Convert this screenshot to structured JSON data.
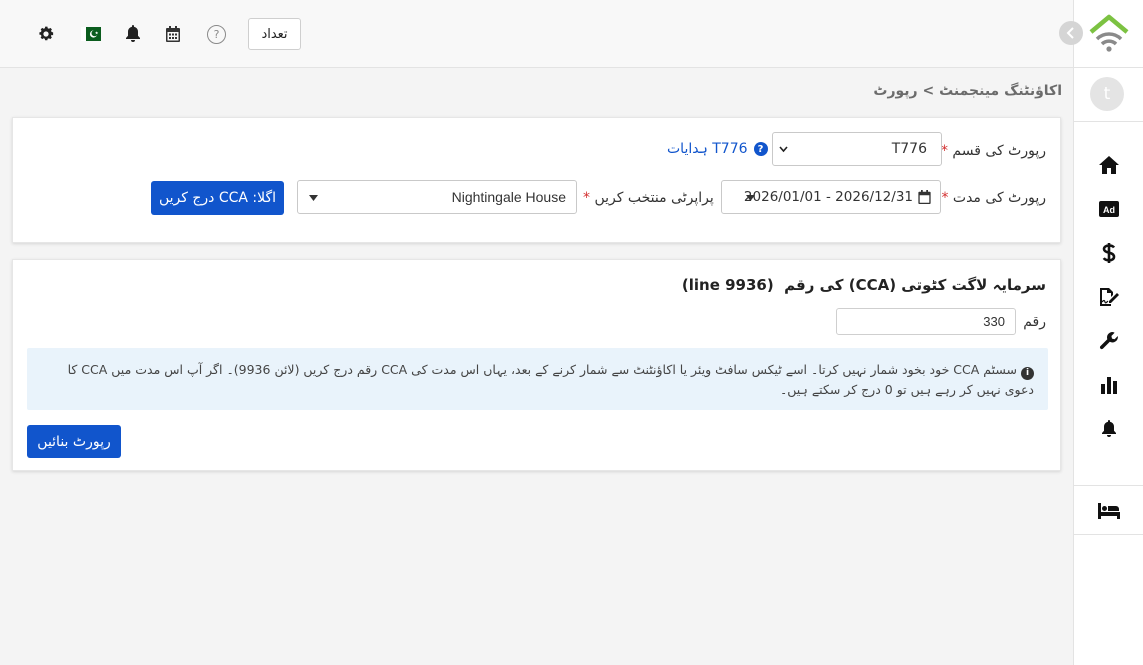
{
  "topbar": {
    "count_button": "تعداد",
    "help_glyph": "?",
    "icons": [
      "gear-icon",
      "pakistan-flag-icon",
      "bell-icon",
      "calendar-icon",
      "help-icon"
    ]
  },
  "sidebar": {
    "avatar_letter": "t",
    "items": [
      "home-icon",
      "ad-icon",
      "dollar-icon",
      "file-signature-icon",
      "wrench-icon",
      "chart-bar-icon",
      "bell-icon",
      "bed-icon"
    ],
    "logo_colors": {
      "roof": "#7cc242",
      "wifi": "#888888"
    }
  },
  "breadcrumb": {
    "parent": "اکاؤنٹنگ مینجمنٹ",
    "separator": ">",
    "current": "رپورٹ"
  },
  "form": {
    "report_type_label": "رپورٹ کی قسم",
    "report_type_value": "T776",
    "instructions_link": "T776 ہدایات",
    "period_label": "رپورٹ کی مدت",
    "period_value": "2026/01/01 - 2026/12/31",
    "property_label": "پراپرٹی منتخب کریں",
    "property_value": "Nightingale House",
    "next_button": "اگلا: CCA درج کریں",
    "required_mark": "*"
  },
  "cca": {
    "title": "سرمایہ لاگت کٹوتی (CCA) کی رقم  (line 9936)",
    "amount_label": "رقم",
    "amount_value": "330",
    "info_text": "سسٹم CCA خود بخود شمار نہیں کرتا۔ اسے ٹیکس سافٹ ویئر یا اکاؤنٹنٹ سے شمار کرنے کے بعد، یہاں اس مدت کی CCA رقم درج کریں (لائن 9936)۔ اگر آپ اس مدت میں CCA کا دعوی نہیں کر رہے ہیں تو 0 درج کر سکتے ہیں۔",
    "create_button": "رپورٹ بنائیں"
  },
  "colors": {
    "primary": "#1155cc",
    "required": "#d32f2f",
    "info_bg": "#e9f3fb",
    "link": "#1155cc"
  }
}
